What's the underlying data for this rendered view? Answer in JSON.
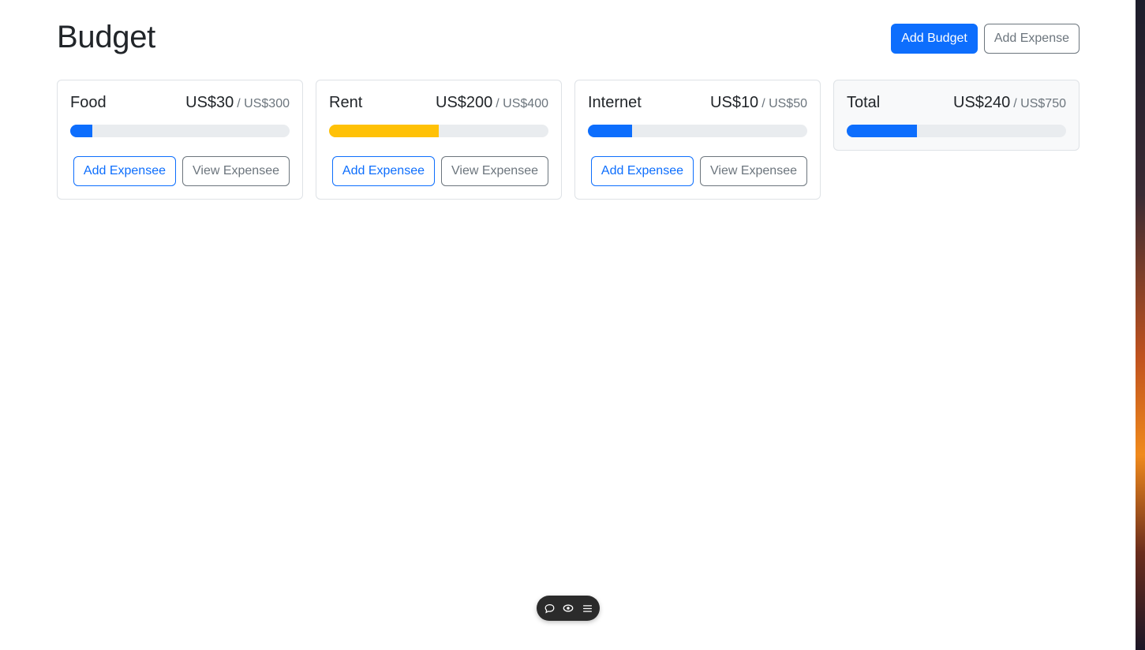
{
  "page": {
    "title": "Budget"
  },
  "header": {
    "add_budget_label": "Add Budget",
    "add_expense_label": "Add Expense"
  },
  "colors": {
    "primary": "#0d6efd",
    "warning": "#ffc107",
    "secondary": "#6c757d",
    "track": "#e9ecef"
  },
  "budgets": [
    {
      "name": "Food",
      "amount": "US$30",
      "max": "/ US$300",
      "progress": 0.1,
      "bar_color": "#0d6efd",
      "add_label": "Add Expensee",
      "view_label": "View Expensee"
    },
    {
      "name": "Rent",
      "amount": "US$200",
      "max": "/ US$400",
      "progress": 0.5,
      "bar_color": "#ffc107",
      "add_label": "Add Expensee",
      "view_label": "View Expensee"
    },
    {
      "name": "Internet",
      "amount": "US$10",
      "max": "/ US$50",
      "progress": 0.2,
      "bar_color": "#0d6efd",
      "add_label": "Add Expensee",
      "view_label": "View Expensee"
    }
  ],
  "total": {
    "name": "Total",
    "amount": "US$240",
    "max": "/ US$750",
    "progress": 0.32,
    "bar_color": "#0d6efd"
  },
  "toolbar": {
    "icons": [
      "comment-icon",
      "eye-icon",
      "menu-icon"
    ]
  }
}
